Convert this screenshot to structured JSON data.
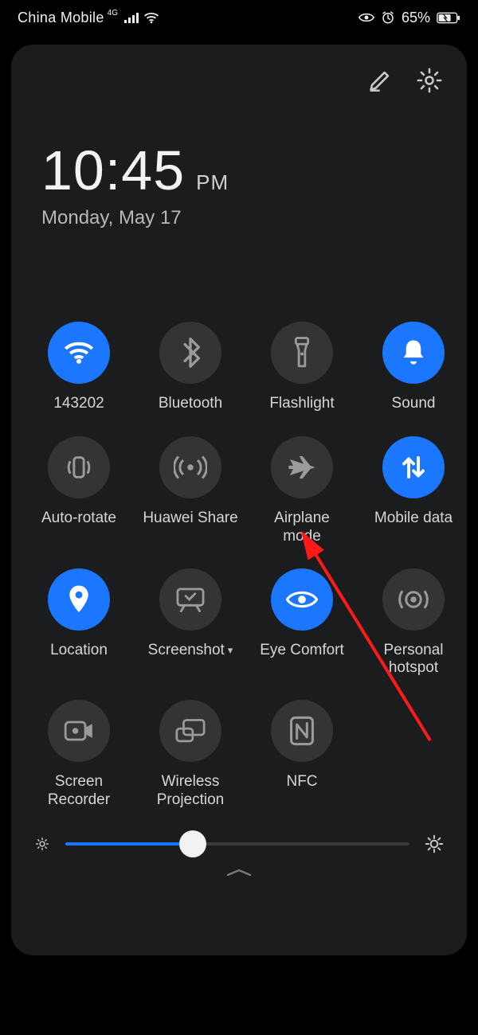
{
  "status": {
    "carrier": "China Mobile",
    "network_badge": "4G",
    "battery_pct": "65%"
  },
  "panel": {
    "time": "10:45",
    "ampm": "PM",
    "date": "Monday, May 17"
  },
  "tiles": [
    {
      "id": "wifi",
      "label": "143202",
      "on": true,
      "icon": "wifi"
    },
    {
      "id": "bluetooth",
      "label": "Bluetooth",
      "on": false,
      "icon": "bluetooth"
    },
    {
      "id": "flashlight",
      "label": "Flashlight",
      "on": false,
      "icon": "flashlight"
    },
    {
      "id": "sound",
      "label": "Sound",
      "on": true,
      "icon": "bell"
    },
    {
      "id": "autorotate",
      "label": "Auto-rotate",
      "on": false,
      "icon": "rotate"
    },
    {
      "id": "huaweishare",
      "label": "Huawei Share",
      "on": false,
      "icon": "broadcast"
    },
    {
      "id": "airplane",
      "label": "Airplane\nmode",
      "on": false,
      "icon": "plane"
    },
    {
      "id": "mobiledata",
      "label": "Mobile data",
      "on": true,
      "icon": "updown"
    },
    {
      "id": "location",
      "label": "Location",
      "on": true,
      "icon": "pin"
    },
    {
      "id": "screenshot",
      "label": "Screenshot",
      "on": false,
      "icon": "screenshot",
      "dropdown": true
    },
    {
      "id": "eyecomfort",
      "label": "Eye Comfort",
      "on": true,
      "icon": "eye"
    },
    {
      "id": "hotspot",
      "label": "Personal\nhotspot",
      "on": false,
      "icon": "hotspot"
    },
    {
      "id": "screenrecorder",
      "label": "Screen\nRecorder",
      "on": false,
      "icon": "record"
    },
    {
      "id": "wirelessproj",
      "label": "Wireless\nProjection",
      "on": false,
      "icon": "cast"
    },
    {
      "id": "nfc",
      "label": "NFC",
      "on": false,
      "icon": "nfc"
    }
  ],
  "brightness": {
    "percent": 37
  },
  "annotation": {
    "arrow_target_tile": "airplane"
  },
  "colors": {
    "accent": "#1b77ff",
    "panel": "#1b1c1e",
    "tile_off": "#333436"
  }
}
